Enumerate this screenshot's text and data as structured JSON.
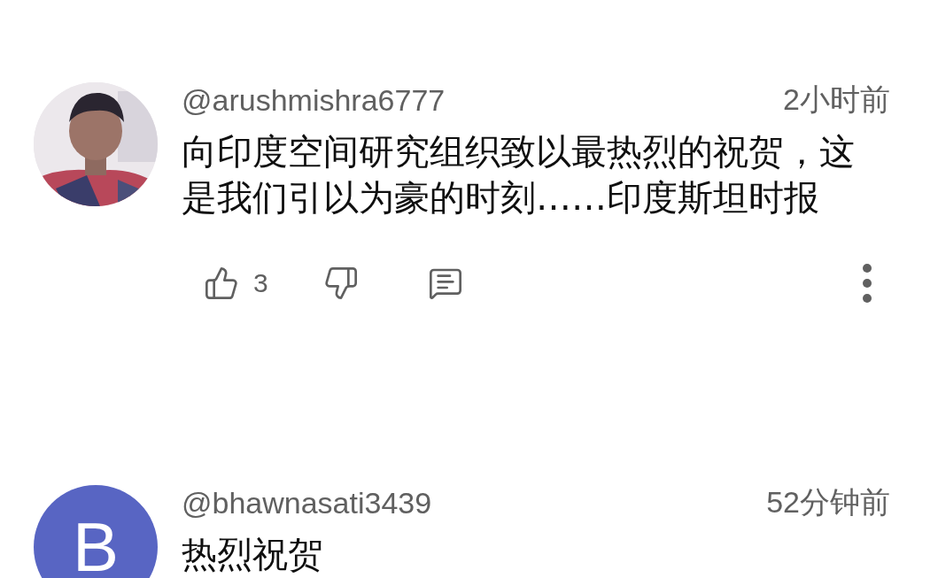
{
  "comments": [
    {
      "author": "@arushmishra6777",
      "time": "2小时前",
      "text": "向印度空间研究组织致以最热烈的祝贺，这是我们引以为豪的时刻……印度斯坦时报",
      "likes": "3"
    },
    {
      "author": "@bhawnasati3439",
      "time": "52分钟前",
      "text": "热烈祝贺",
      "avatar": {
        "kind": "letter",
        "letter": "B",
        "color": "#5865c3"
      }
    }
  ]
}
